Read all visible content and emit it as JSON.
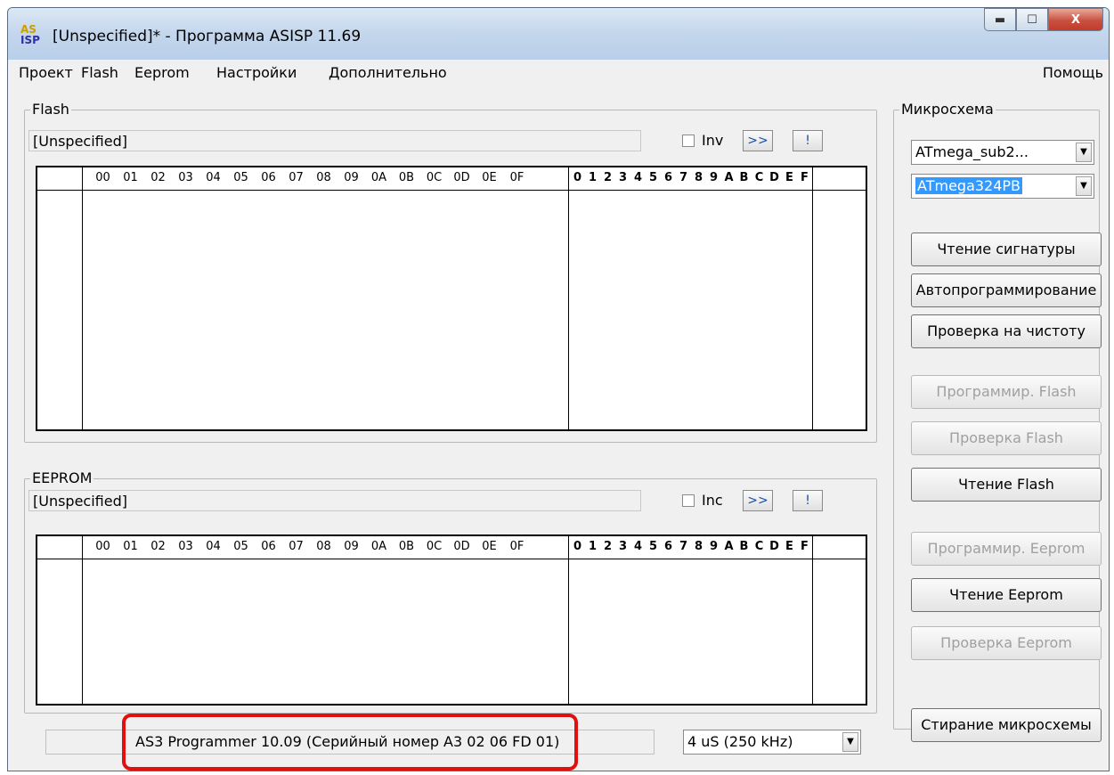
{
  "window": {
    "title": "[Unspecified]* - Программа ASISP 11.69",
    "icon_top": "AS",
    "icon_bottom": "ISP",
    "buttons": {
      "minimize": "▬",
      "maximize": "☐",
      "close": "X"
    }
  },
  "menu": {
    "items": [
      "Проект",
      "Flash",
      "Eeprom",
      "Настройки",
      "Дополнительно"
    ],
    "help": "Помощь"
  },
  "flash": {
    "legend": "Flash",
    "file": "[Unspecified]",
    "option_label": "Inv",
    "option_checked": false,
    "btn_next": ">>",
    "btn_excl": "!"
  },
  "eeprom": {
    "legend": "EEPROM",
    "file": "[Unspecified]",
    "option_label": "Inc",
    "option_checked": false,
    "btn_next": ">>",
    "btn_excl": "!"
  },
  "hex_columns": [
    "00",
    "01",
    "02",
    "03",
    "04",
    "05",
    "06",
    "07",
    "08",
    "09",
    "0A",
    "0B",
    "0C",
    "0D",
    "0E",
    "0F"
  ],
  "ascii_columns": [
    "0",
    "1",
    "2",
    "3",
    "4",
    "5",
    "6",
    "7",
    "8",
    "9",
    "A",
    "B",
    "C",
    "D",
    "E",
    "F"
  ],
  "chip": {
    "legend": "Микросхема",
    "family": "ATmega_sub2...",
    "device": "ATmega324PB"
  },
  "actions": [
    {
      "label": "Чтение сигнатуры",
      "enabled": true
    },
    {
      "label": "Автопрограммирование",
      "enabled": true
    },
    {
      "label": "Проверка на чистоту",
      "enabled": true
    },
    {
      "label": "Программир. Flash",
      "enabled": false
    },
    {
      "label": "Проверка Flash",
      "enabled": false
    },
    {
      "label": "Чтение Flash",
      "enabled": true
    },
    {
      "label": "Программир. Eeprom",
      "enabled": false
    },
    {
      "label": "Чтение Eeprom",
      "enabled": true
    },
    {
      "label": "Проверка Eeprom",
      "enabled": false
    },
    {
      "label": "Стирание микросхемы",
      "enabled": true
    }
  ],
  "status": {
    "programmer": "AS3 Programmer 10.09 (Серийный номер A3 02 06 FD 01)",
    "speed": "4 uS  (250 kHz)"
  },
  "colors": {
    "highlight": "#e01010",
    "selection": "#3399ff",
    "disabled_text": "#a0a0a0"
  }
}
